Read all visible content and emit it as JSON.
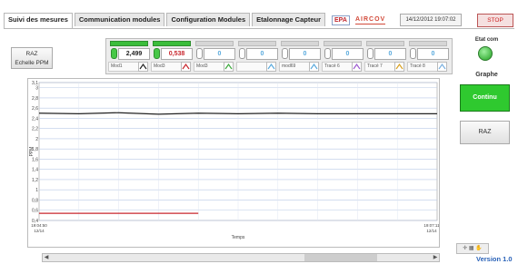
{
  "tabs": [
    {
      "label": "Suivi des mesures",
      "active": true
    },
    {
      "label": "Communication modules",
      "active": false
    },
    {
      "label": "Configuration Modules",
      "active": false
    },
    {
      "label": "Etalonnage Capteur",
      "active": false
    }
  ],
  "header": {
    "logo_epa": "EPA",
    "logo_aircov": "AIRCOV",
    "datetime": "14/12/2012 19:07:02",
    "stop_label": "STOP"
  },
  "raz_ppm_label_line1": "RAZ",
  "raz_ppm_label_line2": "Echelle PPM",
  "modules": [
    {
      "value": "2,499",
      "active": true,
      "legend": "Mod1",
      "color": "#222222"
    },
    {
      "value": "0,538",
      "active": true,
      "legend": "Mod3",
      "color": "#c8262d"
    },
    {
      "value": "0",
      "active": false,
      "legend": "Mod3",
      "color": "#3aa83a"
    },
    {
      "value": "0",
      "active": false,
      "legend": "",
      "color": "#5aaadd"
    },
    {
      "value": "0",
      "active": false,
      "legend": "mod69",
      "color": "#5aaadd"
    },
    {
      "value": "0",
      "active": false,
      "legend": "Tracé 6",
      "color": "#9c5ad0"
    },
    {
      "value": "0",
      "active": false,
      "legend": "Tracé 7",
      "color": "#d8a020"
    },
    {
      "value": "0",
      "active": false,
      "legend": "Tracé 8",
      "color": "#7ab0e0"
    }
  ],
  "right_panel": {
    "stat_label": "Etat com",
    "graphe_label": "Graphe",
    "continu_label": "Continu",
    "raz_label": "RAZ",
    "version": "Version 1.0",
    "tools_glyphs": "✛ ▦ ✋"
  },
  "chart_data": {
    "type": "line",
    "ylabel": "PPM",
    "xlabel": "Temps",
    "ylim": [
      0.4,
      3.1
    ],
    "yticks": [
      "3,1",
      "3",
      "2,8",
      "2,6",
      "2,4",
      "2,2",
      "2",
      "1,8",
      "1,6",
      "1,4",
      "1,2",
      "1",
      "0,8",
      "0,6",
      "0,4"
    ],
    "x_start_label": [
      "19:04:50",
      "12/14"
    ],
    "x_end_label": [
      "19:07:11",
      "12/14"
    ],
    "grid": true,
    "series": [
      {
        "name": "Mod1",
        "color": "#222222",
        "x": [
          0,
          0.1,
          0.2,
          0.3,
          0.4,
          0.5,
          0.6,
          0.7,
          0.8,
          0.9,
          1.0
        ],
        "values": [
          2.5,
          2.49,
          2.51,
          2.48,
          2.5,
          2.49,
          2.5,
          2.49,
          2.49,
          2.49,
          2.49
        ]
      },
      {
        "name": "Mod3",
        "color": "#c8262d",
        "x": [
          0,
          0.4
        ],
        "values": [
          0.54,
          0.54
        ]
      }
    ]
  }
}
